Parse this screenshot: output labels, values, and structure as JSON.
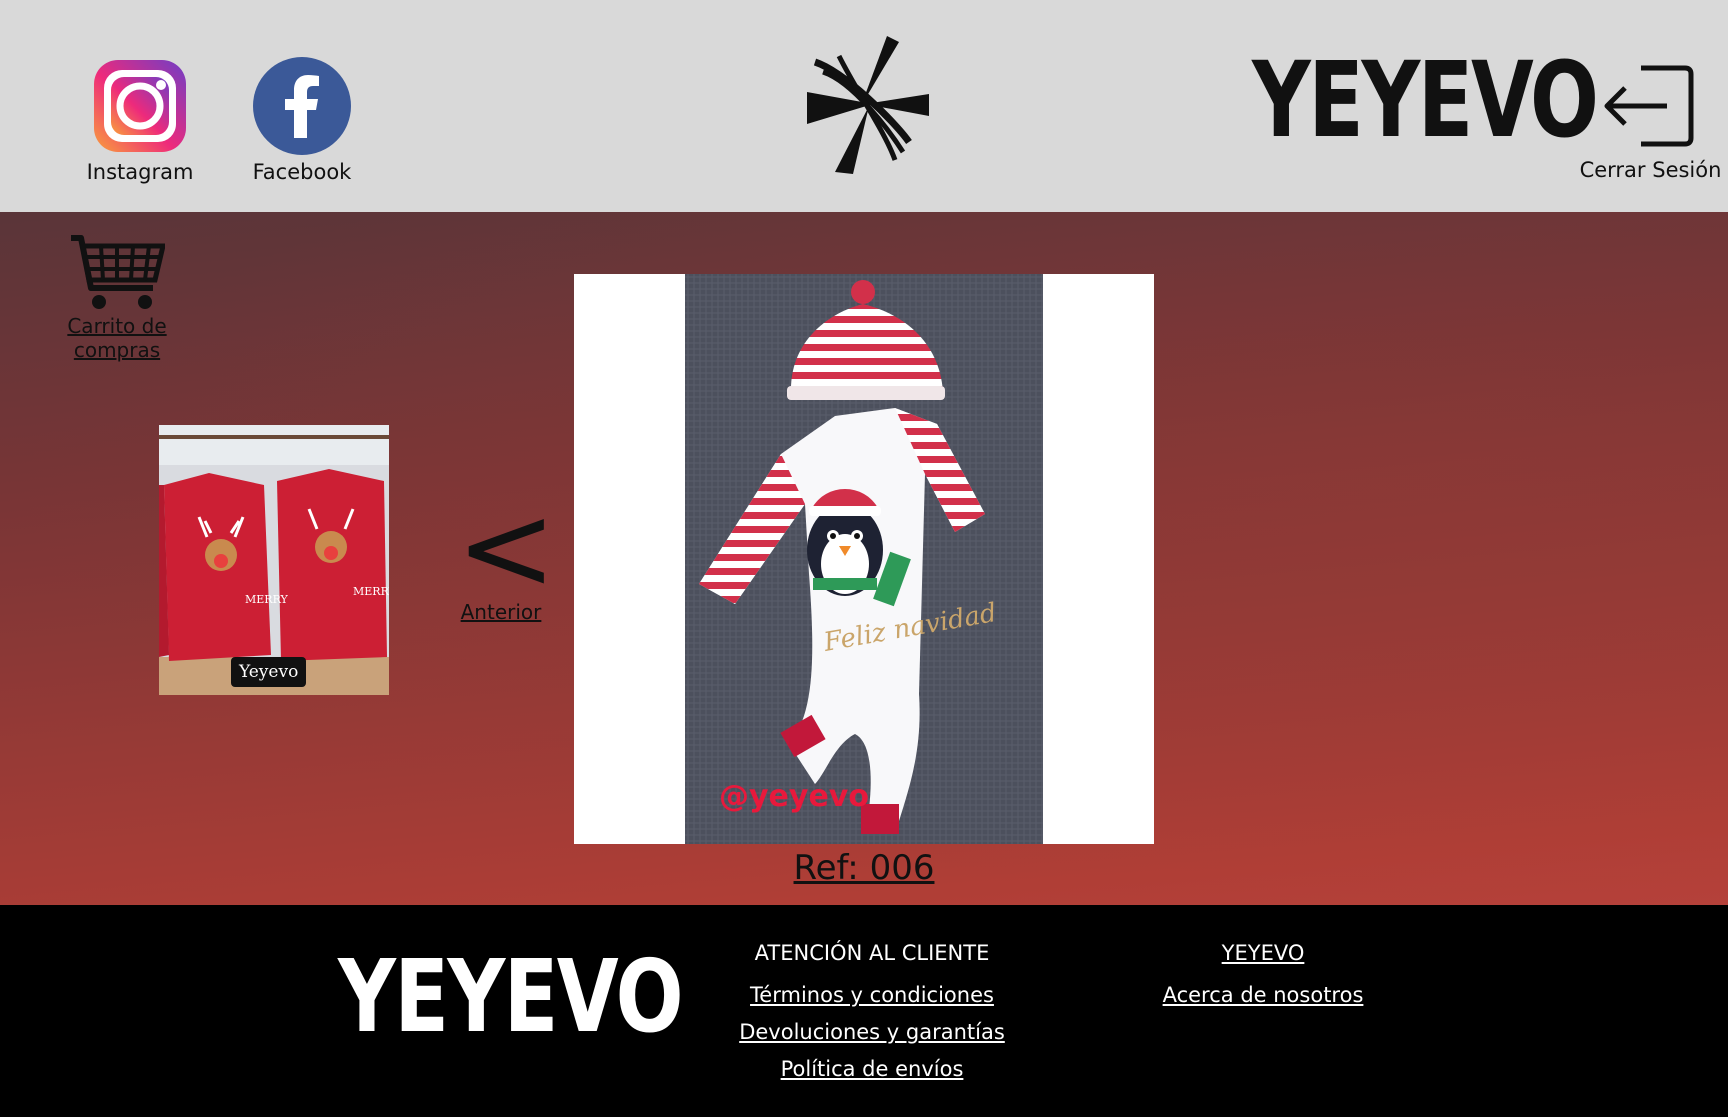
{
  "header": {
    "instagram_label": "Instagram",
    "facebook_label": "Facebook",
    "brand": "YEYEVO",
    "logout_label": "Cerrar Sesión",
    "colors": {
      "background": "#d9d9d9",
      "facebook": "#3b5998"
    }
  },
  "main": {
    "cart_label": "Carrito de compras",
    "prev_arrow": "<",
    "prev_label": "Anterior",
    "thumb_badge": "Yeyevo",
    "product_image_watermark": "@yeyevo",
    "product_image_text": "Feliz navidad",
    "ref_label": "Ref: 006",
    "colors": {
      "gradient_top": "#5a3539",
      "gradient_bottom": "#b5413a"
    }
  },
  "footer": {
    "brand": "YEYEVO",
    "customer_service": {
      "heading": "ATENCIÓN AL CLIENTE",
      "links": [
        "Términos y condiciones",
        "Devoluciones y garantías",
        "Política de envíos"
      ]
    },
    "company": {
      "heading": "YEYEVO",
      "links": [
        "Acerca de nosotros"
      ]
    }
  },
  "icons": [
    "instagram-icon",
    "facebook-icon",
    "brand-mark-icon",
    "logout-icon",
    "shopping-cart-icon"
  ]
}
